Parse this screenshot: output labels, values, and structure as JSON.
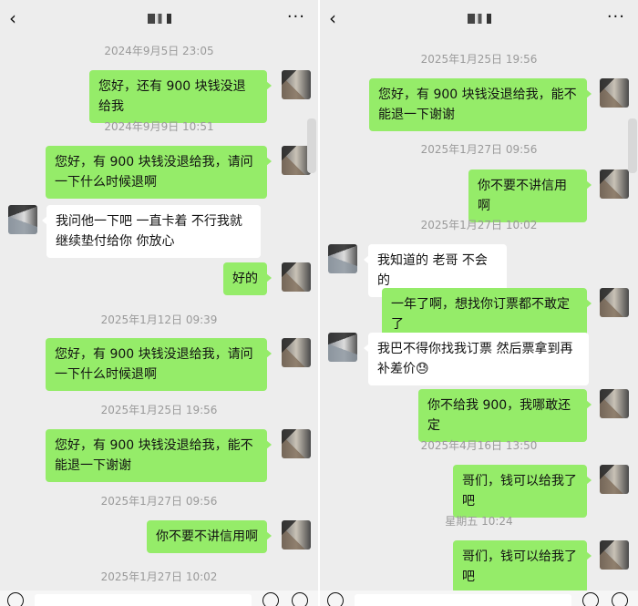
{
  "header": {
    "back_icon": "‹",
    "more_icon": "···"
  },
  "left": {
    "messages": [
      {
        "time": "2024年9月5日 23:05"
      },
      {
        "text": "您好，还有 900 块钱没退给我"
      },
      {
        "time": "2024年9月9日 10:51"
      },
      {
        "text": "您好，有 900 块钱没退给我，请问一下什么时候退啊"
      },
      {
        "text": "我问他一下吧 一直卡着 不行我就继续垫付给你 你放心"
      },
      {
        "text": "好的"
      },
      {
        "time": "2025年1月12日 09:39"
      },
      {
        "text": "您好，有 900 块钱没退给我，请问一下什么时候退啊"
      },
      {
        "time": "2025年1月25日 19:56"
      },
      {
        "text": "您好，有 900 块钱没退给我，能不能退一下谢谢"
      },
      {
        "time": "2025年1月27日 09:56"
      },
      {
        "text": "你不要不讲信用啊"
      },
      {
        "time": "2025年1月27日 10:02"
      }
    ]
  },
  "right": {
    "messages": [
      {
        "time": "2025年1月25日 19:56"
      },
      {
        "text": "您好，有 900 块钱没退给我，能不能退一下谢谢"
      },
      {
        "time": "2025年1月27日 09:56"
      },
      {
        "text": "你不要不讲信用啊"
      },
      {
        "time": "2025年1月27日 10:02"
      },
      {
        "text": "我知道的 老哥 不会的"
      },
      {
        "text": "一年了啊，想找你订票都不敢定了"
      },
      {
        "text": "我巴不得你找我订票 然后票拿到再补差价😓"
      },
      {
        "text": "你不给我 900，我哪敢还定"
      },
      {
        "time": "2025年4月16日 13:50"
      },
      {
        "text": "哥们，钱可以给我了吧"
      },
      {
        "time": "星期五 10:24"
      },
      {
        "text": "哥们，钱可以给我了吧"
      }
    ]
  },
  "colors": {
    "sent_bubble": "#95ec69",
    "received_bubble": "#ffffff",
    "background": "#ededed",
    "timestamp": "#9a9a9a"
  }
}
